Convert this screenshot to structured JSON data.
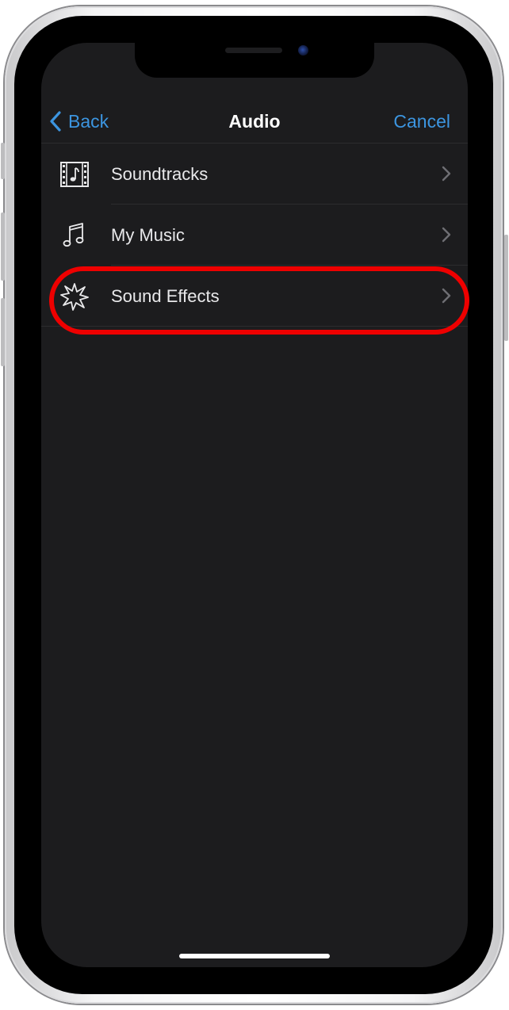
{
  "nav": {
    "back_label": "Back",
    "title": "Audio",
    "cancel_label": "Cancel"
  },
  "list": {
    "items": [
      {
        "label": "Soundtracks",
        "icon": "film-music-icon"
      },
      {
        "label": "My Music",
        "icon": "music-note-icon"
      },
      {
        "label": "Sound Effects",
        "icon": "starburst-icon"
      }
    ]
  },
  "colors": {
    "accent": "#3c95e0",
    "background": "#1c1c1e",
    "highlight": "#ee0000"
  }
}
